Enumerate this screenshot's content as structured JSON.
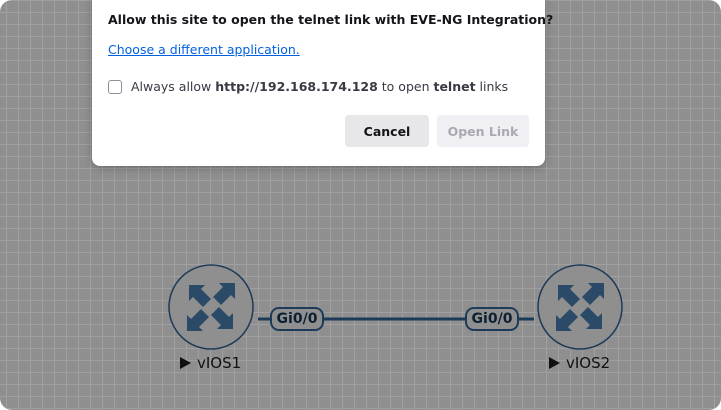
{
  "dialog": {
    "title": "Allow this site to open the telnet link with EVE-NG Integration?",
    "choose_link": "Choose a different application.",
    "always_allow": {
      "prefix": "Always allow ",
      "host": "http://192.168.174.128",
      "middle": " to open ",
      "protocol": "telnet",
      "suffix": " links"
    },
    "cancel_label": "Cancel",
    "open_label": "Open Link"
  },
  "topology": {
    "nodes": [
      {
        "name": "vIOS1",
        "icon": "router-icon"
      },
      {
        "name": "vIOS2",
        "icon": "router-icon"
      }
    ],
    "link": {
      "port_a": "Gi0/0",
      "port_b": "Gi0/0"
    }
  },
  "colors": {
    "canvas": "#8f8f8f",
    "grid": "#a0a0a0",
    "router": "#1d3b58",
    "router_fill": "#8f8f8f",
    "link_accent": "#0061e0"
  }
}
